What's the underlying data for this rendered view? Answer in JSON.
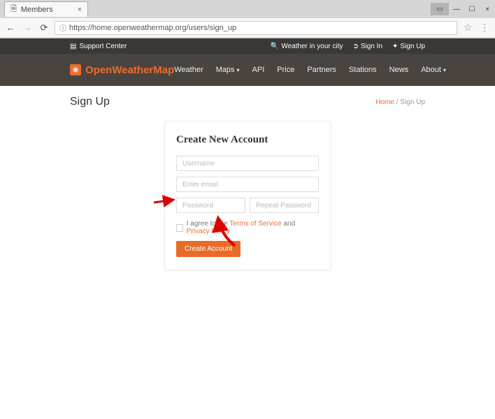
{
  "browser": {
    "tab_title": "Members",
    "url": "https://home.openweathermap.org/users/sign_up"
  },
  "topbar": {
    "support": "Support Center",
    "weather": "Weather in your city",
    "signin": "Sign In",
    "signup": "Sign Up"
  },
  "logo_text": "OpenWeatherMap",
  "nav": {
    "weather": "Weather",
    "maps": "Maps",
    "api": "API",
    "price": "Price",
    "partners": "Partners",
    "stations": "Stations",
    "news": "News",
    "about": "About"
  },
  "page_title": "Sign Up",
  "breadcrumb": {
    "home": "Home",
    "current": "Sign Up"
  },
  "form": {
    "title": "Create New Account",
    "username_ph": "Username",
    "email_ph": "Enter email",
    "password_ph": "Password",
    "repeat_ph": "Repeat Password",
    "agree_prefix": "I agree to the ",
    "tos": "Terms of Service",
    "and": " and ",
    "privacy": "Privacy Policy",
    "submit": "Create Account"
  }
}
